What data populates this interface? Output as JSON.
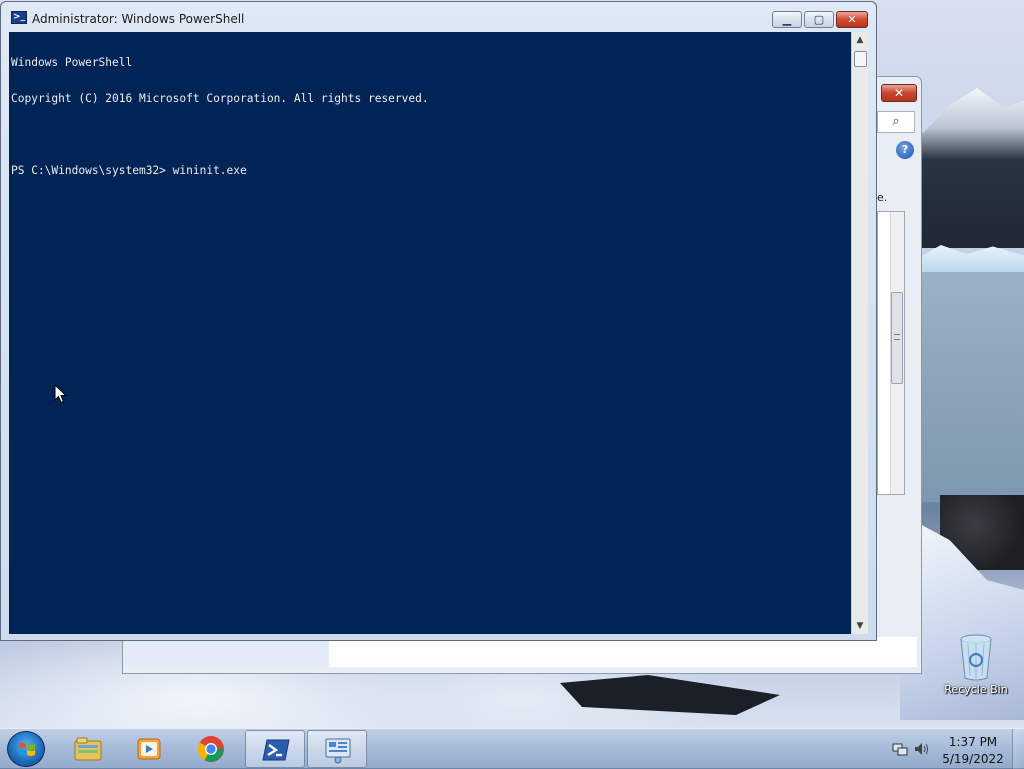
{
  "powershell": {
    "title": "Administrator: Windows PowerShell",
    "icon": "powershell-icon",
    "console_lines": [
      "Windows PowerShell",
      "Copyright (C) 2016 Microsoft Corporation. All rights reserved.",
      "",
      "PS C:\\Windows\\system32> wininit.exe"
    ],
    "colors": {
      "console_bg": "#012456",
      "console_fg": "#eeedf0"
    }
  },
  "background_window": {
    "text_fragment": "e."
  },
  "desktop": {
    "recycle_bin_label": "Recycle Bin"
  },
  "taskbar": {
    "apps": [
      {
        "name": "file-explorer-icon"
      },
      {
        "name": "media-player-icon"
      },
      {
        "name": "chrome-icon"
      },
      {
        "name": "powershell-icon"
      },
      {
        "name": "control-panel-icon"
      }
    ],
    "clock": {
      "time": "1:37 PM",
      "date": "5/19/2022"
    }
  }
}
